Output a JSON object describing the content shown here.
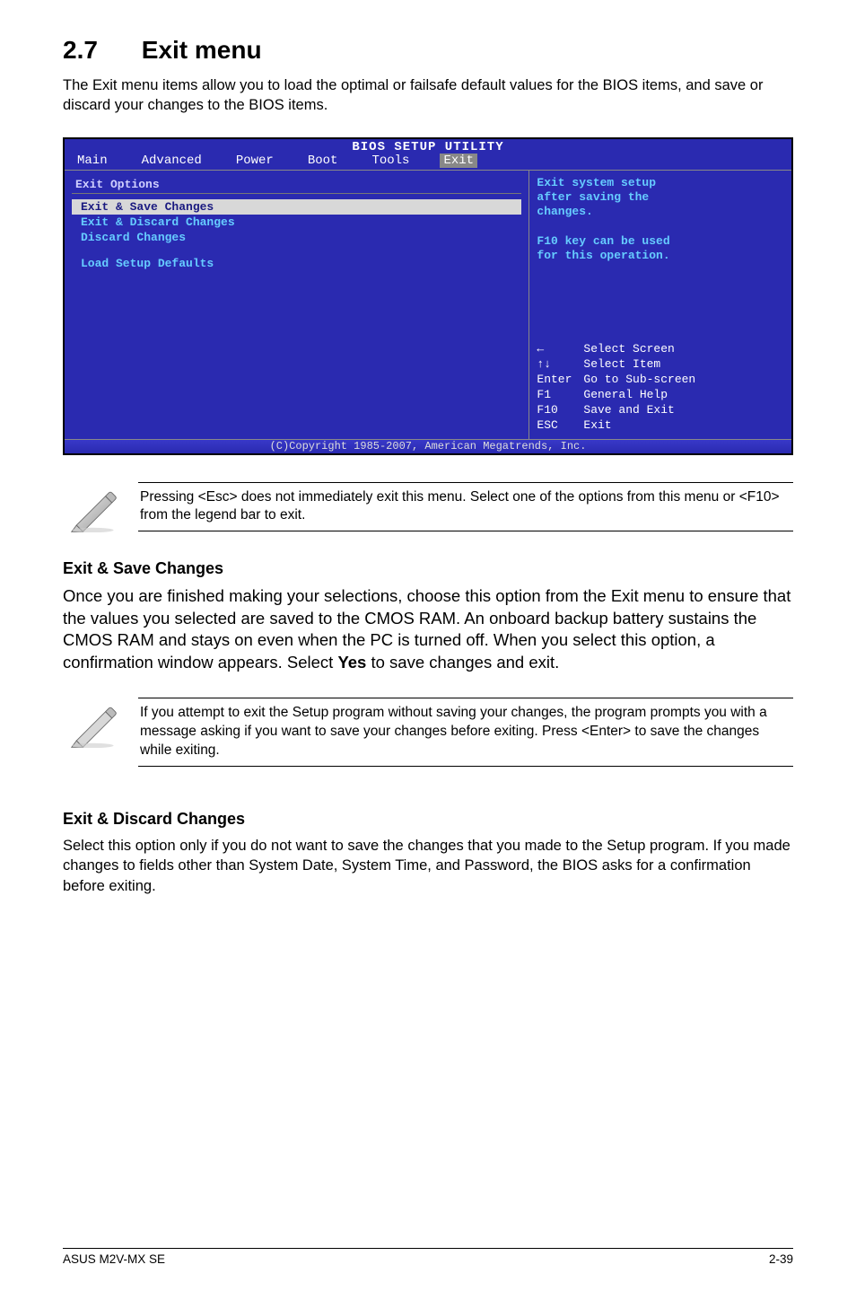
{
  "section": {
    "number": "2.7",
    "title": "Exit menu"
  },
  "intro": "The Exit menu items allow you to load the optimal or failsafe default values for the BIOS items, and save or discard your changes to the BIOS items.",
  "bios": {
    "utility_title": "BIOS SETUP UTILITY",
    "tabs": [
      "Main",
      "Advanced",
      "Power",
      "Boot",
      "Tools",
      "Exit"
    ],
    "active_tab_index": 5,
    "left": {
      "heading": "Exit Options",
      "items": [
        {
          "label": "Exit & Save Changes",
          "selected": true
        },
        {
          "label": "Exit & Discard Changes",
          "selected": false
        },
        {
          "label": "Discard Changes",
          "selected": false
        }
      ],
      "gap_item": {
        "label": "Load Setup Defaults"
      }
    },
    "right": {
      "help_lines": [
        "Exit system setup",
        "after saving the",
        "changes.",
        "",
        "F10 key can be used",
        "for this operation."
      ],
      "keys": [
        {
          "k": "←",
          "v": "Select Screen"
        },
        {
          "k": "↑↓",
          "v": "Select Item"
        },
        {
          "k": "Enter",
          "v": "Go to Sub-screen"
        },
        {
          "k": "F1",
          "v": "General Help"
        },
        {
          "k": "F10",
          "v": "Save and Exit"
        },
        {
          "k": "ESC",
          "v": "Exit"
        }
      ]
    },
    "copyright": "(C)Copyright 1985-2007, American Megatrends, Inc."
  },
  "note1": "Pressing <Esc> does not immediately exit this menu. Select one of the options from this menu or <F10> from the legend bar to exit.",
  "sub1": {
    "heading": "Exit & Save Changes",
    "para": "Once you are finished making your selections, choose this option from the Exit menu to ensure that the values you selected are saved to the CMOS RAM. An onboard backup battery sustains the CMOS RAM and stays on even when the PC is turned off. When you select this option, a confirmation window appears. Select Yes to save changes and exit."
  },
  "note2": " If you attempt to exit the Setup program without saving your changes, the program prompts you with a message asking if you want to save your changes before exiting. Press <Enter>  to save the  changes while exiting.",
  "sub2": {
    "heading": "Exit & Discard Changes",
    "para": "Select this option only if you do not want to save the changes that you  made to the Setup program. If you made changes to fields other than System Date, System Time, and Password, the BIOS asks for a confirmation before exiting."
  },
  "footer": {
    "left": "ASUS M2V-MX SE",
    "right": "2-39"
  }
}
